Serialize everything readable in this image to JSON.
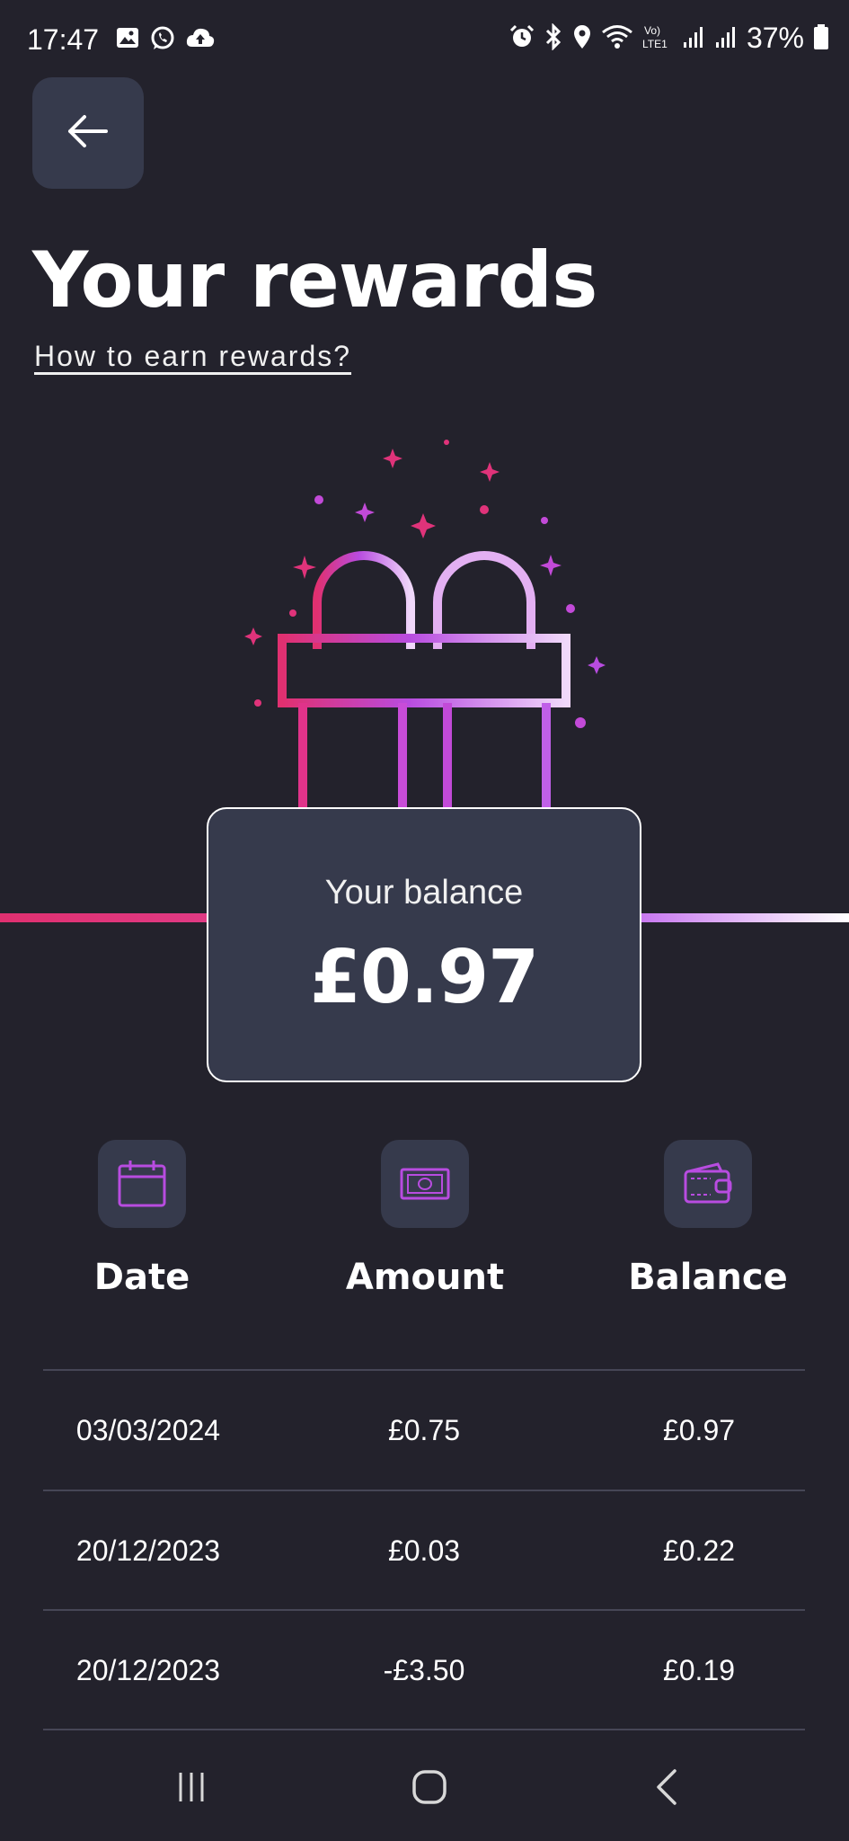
{
  "status_bar": {
    "time": "17:47",
    "battery_percent": "37%",
    "left_icons": [
      "gallery-icon",
      "whatsapp-icon",
      "cloud-upload-icon"
    ],
    "right_icons": [
      "alarm-icon",
      "bluetooth-icon",
      "location-icon",
      "wifi-icon",
      "volte-icon",
      "signal-icon",
      "signal-icon",
      "battery-icon"
    ]
  },
  "header": {
    "back_icon": "arrow-left-icon",
    "title": "Your rewards",
    "help_link": "How to earn rewards?"
  },
  "illustration": {
    "icon": "gift-icon"
  },
  "balance": {
    "label": "Your balance",
    "value": "£0.97"
  },
  "table": {
    "columns": [
      {
        "label": "Date",
        "icon": "calendar-icon"
      },
      {
        "label": "Amount",
        "icon": "banknote-icon"
      },
      {
        "label": "Balance",
        "icon": "wallet-icon"
      }
    ],
    "rows": [
      [
        "03/03/2024",
        "£0.75",
        "£0.97"
      ],
      [
        "20/12/2023",
        "£0.03",
        "£0.22"
      ],
      [
        "20/12/2023",
        "-£3.50",
        "£0.19"
      ]
    ]
  },
  "nav_bar": {
    "buttons": [
      "recent-apps-icon",
      "home-icon",
      "back-icon"
    ]
  },
  "colors": {
    "background": "#23222c",
    "card": "#363a4c",
    "accent_pink": "#e03070",
    "accent_purple": "#b84ce0",
    "accent_light": "#e8c8f8"
  }
}
